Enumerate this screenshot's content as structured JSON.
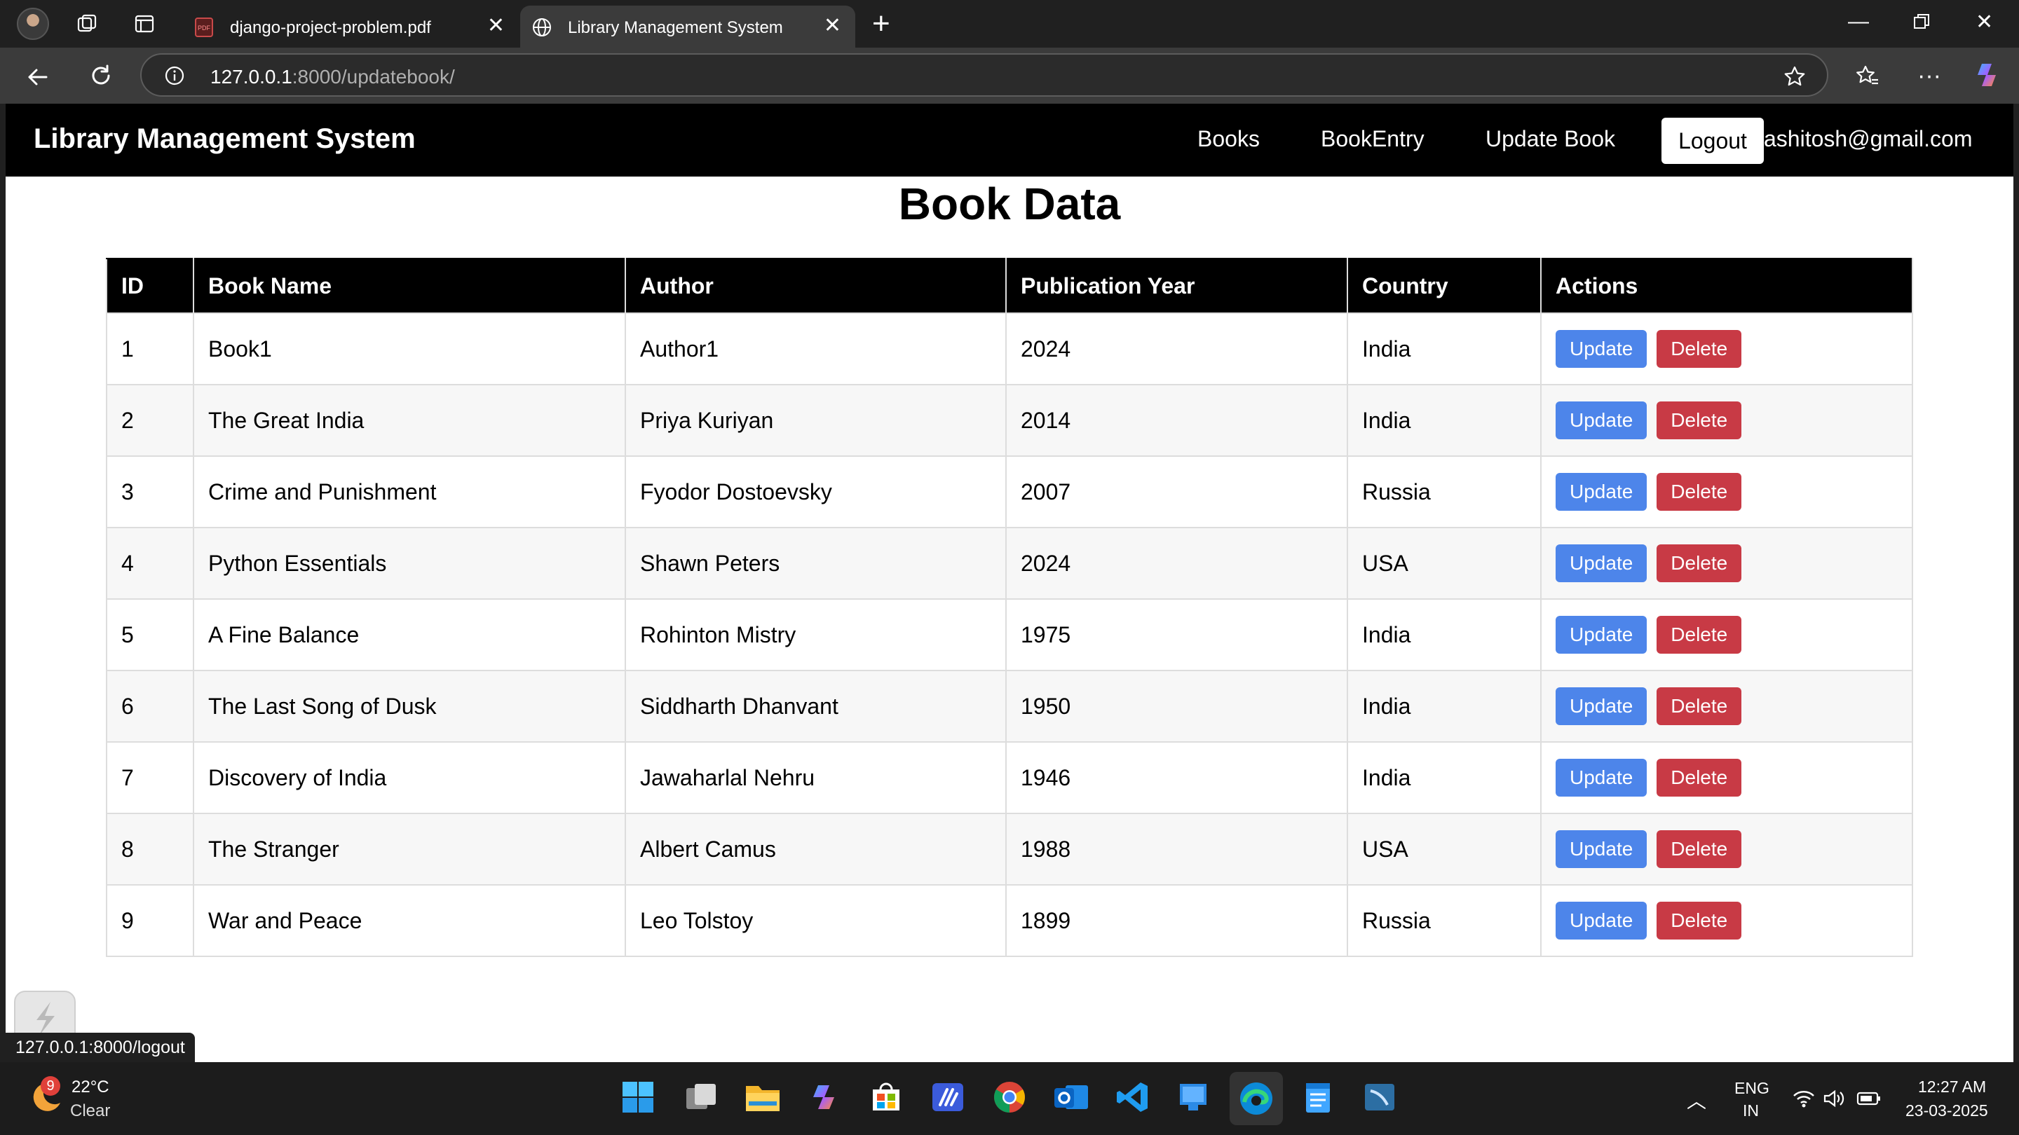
{
  "browser": {
    "tabs": [
      {
        "title": "django-project-problem.pdf",
        "icon": "pdf-icon",
        "active": false
      },
      {
        "title": "Library Management System",
        "icon": "globe-icon",
        "active": true
      }
    ],
    "url": {
      "host": "127.0.0.1",
      "rest": ":8000/updatebook/"
    }
  },
  "navbar": {
    "brand": "Library Management System",
    "links": [
      "Books",
      "BookEntry",
      "Update Book"
    ],
    "logout_label": "Logout",
    "user_email": "ashitosh@gmail.com"
  },
  "page": {
    "title": "Book Data"
  },
  "table": {
    "columns": [
      "ID",
      "Book Name",
      "Author",
      "Publication Year",
      "Country",
      "Actions"
    ],
    "update_label": "Update",
    "delete_label": "Delete",
    "rows": [
      {
        "id": "1",
        "name": "Book1",
        "author": "Author1",
        "year": "2024",
        "country": "India"
      },
      {
        "id": "2",
        "name": "The Great India",
        "author": "Priya Kuriyan",
        "year": "2014",
        "country": "India"
      },
      {
        "id": "3",
        "name": "Crime and Punishment",
        "author": "Fyodor Dostoevsky",
        "year": "2007",
        "country": "Russia"
      },
      {
        "id": "4",
        "name": "Python Essentials",
        "author": "Shawn Peters",
        "year": "2024",
        "country": "USA"
      },
      {
        "id": "5",
        "name": "A Fine Balance",
        "author": "Rohinton Mistry",
        "year": "1975",
        "country": "India"
      },
      {
        "id": "6",
        "name": "The Last Song of Dusk",
        "author": "Siddharth Dhanvant",
        "year": "1950",
        "country": "India"
      },
      {
        "id": "7",
        "name": "Discovery of India",
        "author": "Jawaharlal Nehru",
        "year": "1946",
        "country": "India"
      },
      {
        "id": "8",
        "name": "The Stranger",
        "author": "Albert Camus",
        "year": "1988",
        "country": "USA"
      },
      {
        "id": "9",
        "name": "War and Peace",
        "author": "Leo Tolstoy",
        "year": "1899",
        "country": "Russia"
      }
    ]
  },
  "status_bar": {
    "link": "127.0.0.1:8000/logout"
  },
  "taskbar": {
    "weather_badge": "9",
    "temperature": "22°C",
    "condition": "Clear",
    "language": "ENG",
    "region": "IN",
    "time": "12:27 AM",
    "date": "23-03-2025"
  },
  "colors": {
    "navbar_bg": "#000000",
    "update_button": "#4d85ea",
    "delete_button": "#c83a45",
    "header_bg": "#000000"
  }
}
